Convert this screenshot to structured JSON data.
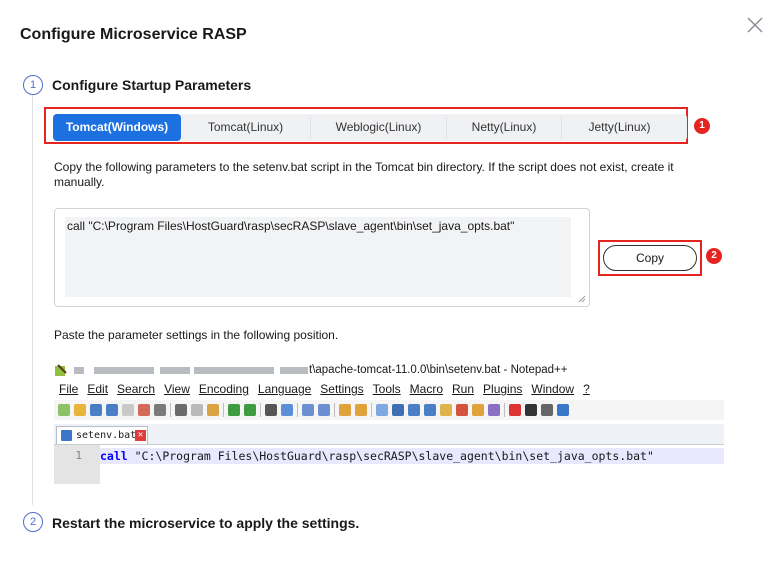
{
  "dialog": {
    "title": "Configure Microservice RASP",
    "close_icon": "close-icon"
  },
  "steps": [
    {
      "number": "1",
      "title": "Configure Startup Parameters"
    },
    {
      "number": "2",
      "title": "Restart the microservice to apply the settings."
    }
  ],
  "tabs": [
    {
      "label": "Tomcat(Windows)",
      "active": true
    },
    {
      "label": "Tomcat(Linux)",
      "active": false
    },
    {
      "label": "Weblogic(Linux)",
      "active": false
    },
    {
      "label": "Netty(Linux)",
      "active": false
    },
    {
      "label": "Jetty(Linux)",
      "active": false
    }
  ],
  "annotations": {
    "badge1": "1",
    "badge2": "2"
  },
  "description": "Copy the following parameters to the setenv.bat script in the Tomcat bin directory. If the script does not exist, create it manually.",
  "code": {
    "value": "call \"C:\\Program Files\\HostGuard\\rasp\\secRASP\\slave_agent\\bin\\set_java_opts.bat\""
  },
  "copy_button": "Copy",
  "paste_label": "Paste the parameter settings in the following position.",
  "notepad": {
    "title_suffix": "t\\apache-tomcat-11.0.0\\bin\\setenv.bat - Notepad++",
    "menu": [
      "File",
      "Edit",
      "Search",
      "View",
      "Encoding",
      "Language",
      "Settings",
      "Tools",
      "Macro",
      "Run",
      "Plugins",
      "Window",
      "?"
    ],
    "tab_label": "setenv.bat",
    "tab_close": "✕",
    "line_number": "1",
    "code_keyword": "call",
    "code_string": " \"C:\\Program Files\\HostGuard\\rasp\\secRASP\\slave_agent\\bin\\set_java_opts.bat\""
  },
  "colors": {
    "accent": "#1d70e0",
    "step": "#526ecc",
    "highlight": "#e4251f"
  }
}
